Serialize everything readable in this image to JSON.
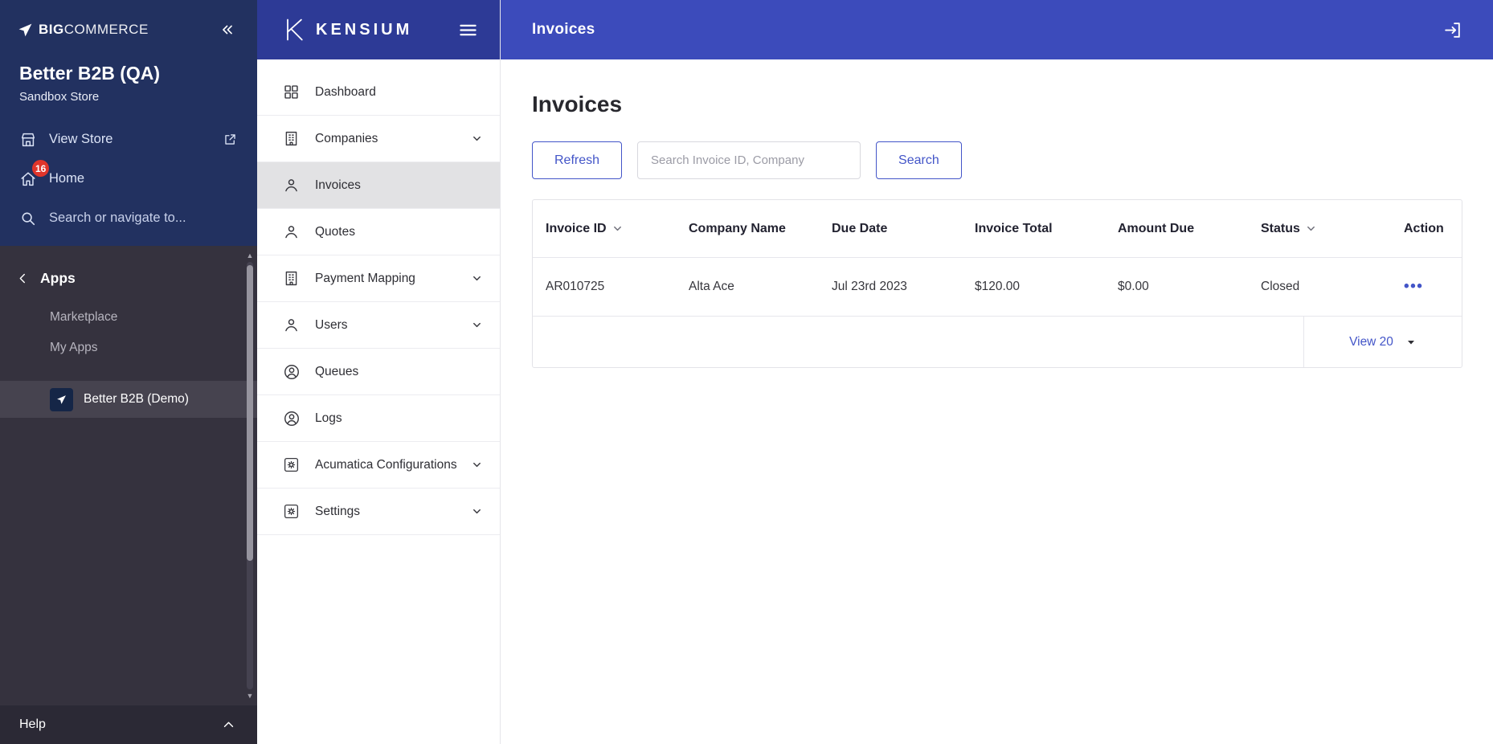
{
  "bigcommerce": {
    "logo_bold": "BIG",
    "logo_light": "COMMERCE",
    "store_name": "Better B2B (QA)",
    "store_type": "Sandbox Store",
    "view_store_label": "View Store",
    "home_label": "Home",
    "home_badge": "16",
    "search_label": "Search or navigate to...",
    "apps_header": "Apps",
    "apps_links": [
      "Marketplace",
      "My Apps"
    ],
    "active_app": "Better B2B (Demo)",
    "help_label": "Help"
  },
  "kensium": {
    "brand": "KENSIUM",
    "nav": [
      {
        "label": "Dashboard",
        "icon": "dashboard"
      },
      {
        "label": "Companies",
        "icon": "building",
        "expandable": true
      },
      {
        "label": "Invoices",
        "icon": "person",
        "active": true
      },
      {
        "label": "Quotes",
        "icon": "person"
      },
      {
        "label": "Payment Mapping",
        "icon": "building",
        "expandable": true
      },
      {
        "label": "Users",
        "icon": "person",
        "expandable": true
      },
      {
        "label": "Queues",
        "icon": "person-circle"
      },
      {
        "label": "Logs",
        "icon": "person-circle"
      },
      {
        "label": "Acumatica Configurations",
        "icon": "gear",
        "expandable": true
      },
      {
        "label": "Settings",
        "icon": "gear",
        "expandable": true
      }
    ]
  },
  "topbar": {
    "title": "Invoices"
  },
  "main": {
    "heading": "Invoices",
    "refresh_label": "Refresh",
    "search_placeholder": "Search Invoice ID, Company",
    "search_label": "Search",
    "table": {
      "columns": [
        {
          "label": "Invoice ID",
          "sortable": true
        },
        {
          "label": "Company Name"
        },
        {
          "label": "Due Date"
        },
        {
          "label": "Invoice Total"
        },
        {
          "label": "Amount Due"
        },
        {
          "label": "Status",
          "sortable": true
        },
        {
          "label": "Action"
        }
      ],
      "rows": [
        [
          "AR010725",
          "Alta Ace",
          "Jul 23rd 2023",
          "$120.00",
          "$0.00",
          "Closed"
        ]
      ],
      "action_icon": "•••",
      "view_label": "View 20"
    }
  },
  "icons": {
    "bigcommerce": [
      "bigcommerce-logo-icon",
      "double-chevron-left-icon",
      "store-icon",
      "external-link-icon",
      "home-icon",
      "search-icon",
      "chevron-left-icon",
      "app-tile-icon",
      "chevron-up-icon",
      "scrollbar-up-arrow-icon",
      "scrollbar-down-arrow-icon"
    ],
    "kensium": [
      "kensium-logo-icon",
      "hamburger-icon",
      "dashboard-icon",
      "building-icon",
      "person-icon",
      "person-circle-icon",
      "gear-icon",
      "chevron-down-icon"
    ],
    "main": [
      "logout-icon",
      "sort-chevron-icon",
      "actions-ellipsis-icon",
      "chevron-down-icon"
    ]
  },
  "colors": {
    "bc_navy": "#223160",
    "bc_charcoal": "#35323e",
    "bc_active_app_bg": "#46434f",
    "bc_help_bg": "#2b2935",
    "badge_red": "#e0352b",
    "kensium_header_indigo": "#2d3a96",
    "topbar_indigo": "#3c4bbb",
    "accent_blue": "#4355c8",
    "active_nav_bg": "#e2e2e4"
  }
}
